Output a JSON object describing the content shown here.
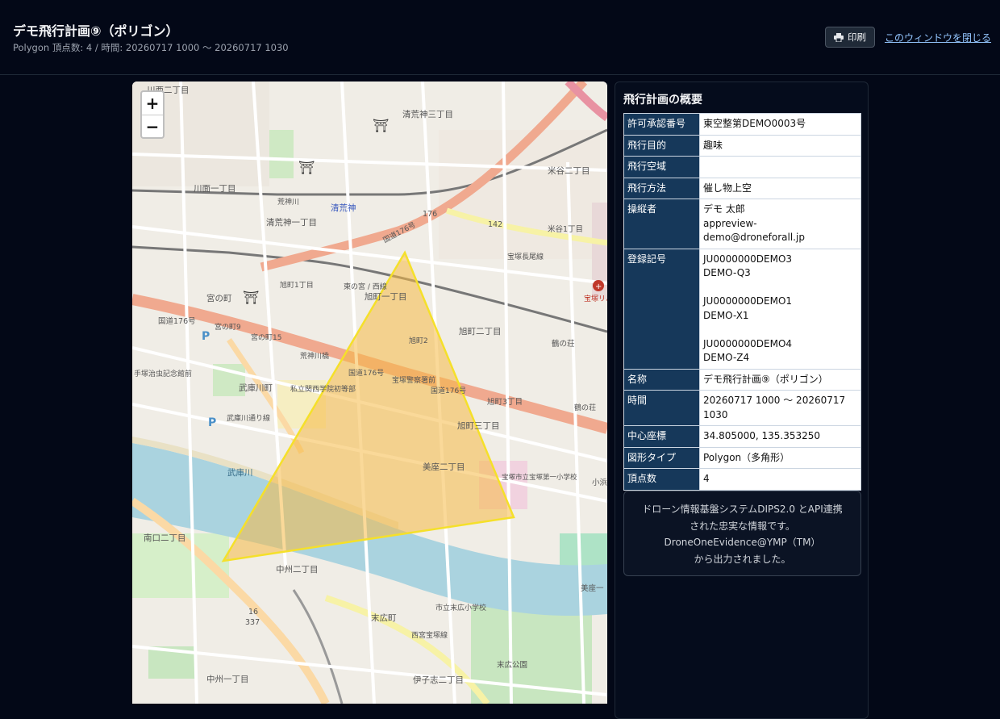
{
  "header": {
    "title": "デモ飛行計画⑨（ポリゴン）",
    "subtitle": "Polygon 頂点数: 4 / 時間: 20260717 1000 〜 20260717 1030",
    "print_label": "印刷",
    "close_label": "このウィンドウを閉じる"
  },
  "map": {
    "zoom_in": "+",
    "zoom_out": "−",
    "polygon_color": "#f5e02a",
    "polygon_fill": "#f5b945",
    "labels": {
      "l01": "川西二丁目",
      "l02": "清荒神三丁目",
      "l03": "米谷二丁目",
      "l04": "川面一丁目",
      "l05": "荒神川",
      "l06": "清荒神",
      "l07": "清荒神一丁目",
      "l08": "176",
      "l09": "142",
      "l10": "米谷1丁目",
      "l11": "国道176号",
      "l12": "宝塚長尾線",
      "l13": "旭町1丁目",
      "l14": "東の宮 / 西線",
      "l15": "旭町一丁目",
      "l16": "宮の町",
      "l17": "国道176号",
      "l18": "宮の町9",
      "l19": "宮の町15",
      "l20": "旭町2",
      "l21": "旭町二丁目",
      "l22": "鶴の荘",
      "l23": "荒神川橋",
      "l24": "国道176号",
      "l25": "宝塚警察署前",
      "l26": "国道176号",
      "l27": "旭町3丁目",
      "l28": "武庫川町",
      "l29": "手塚治虫記念館前",
      "l30": "私立関西学院初等部",
      "l31": "武庫川通り線",
      "l32": "旭町三丁目",
      "l33": "鶴の荘",
      "l34": "美座二丁目",
      "l35": "宝塚市立宝塚第一小学校",
      "l36": "武庫川",
      "l37": "南口二丁目",
      "l38": "中州二丁目",
      "l39": "美座一",
      "l40": "16",
      "l41": "337",
      "l42": "市立末広小学校",
      "l43": "末広町",
      "l44": "西宮宝塚線",
      "l45": "末広公園",
      "l46": "中州一丁目",
      "l47": "伊子志二丁目",
      "l48": "宝塚リハビリテーション病院",
      "l49": "小浜"
    }
  },
  "summary": {
    "title": "飛行計画の概要",
    "rows": [
      {
        "k": "許可承認番号",
        "v": "東空整第DEMO0003号"
      },
      {
        "k": "飛行目的",
        "v": "趣味"
      },
      {
        "k": "飛行空域",
        "v": ""
      },
      {
        "k": "飛行方法",
        "v": "催し物上空"
      },
      {
        "k": "操縦者",
        "v": "デモ 太郎\nappreview-demo@droneforall.jp"
      },
      {
        "k": "登録記号",
        "v": "JU0000000DEMO3\nDEMO-Q3\n\nJU0000000DEMO1\nDEMO-X1\n\nJU0000000DEMO4\nDEMO-Z4"
      },
      {
        "k": "名称",
        "v": "デモ飛行計画⑨（ポリゴン）"
      },
      {
        "k": "時間",
        "v": "20260717 1000 〜 20260717\n1030"
      },
      {
        "k": "中心座標",
        "v": "34.805000, 135.353250"
      },
      {
        "k": "図形タイプ",
        "v": "Polygon（多角形）"
      },
      {
        "k": "頂点数",
        "v": "4"
      }
    ]
  },
  "notice": {
    "line1": "ドローン情報基盤システムDIPS2.0 とAPI連携",
    "line2": "された忠実な情報です。",
    "line3": "DroneOneEvidence@YMP（TM）",
    "line4": "から出力されました。"
  }
}
